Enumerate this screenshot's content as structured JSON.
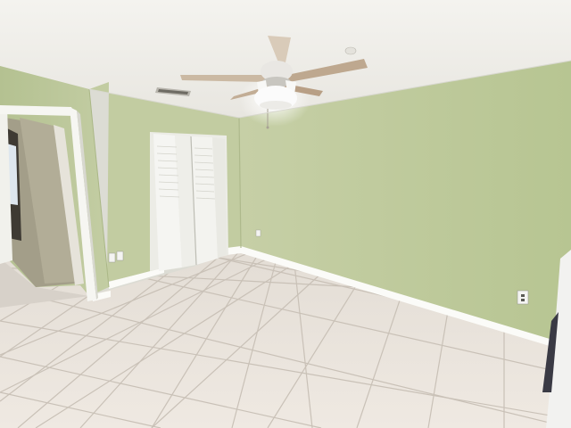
{
  "scene": {
    "description_tags": [
      "empty-bedroom",
      "tile-floor",
      "ceiling-fan",
      "bifold-closet",
      "open-doorway"
    ],
    "colors": {
      "ceiling": "#f1efea",
      "wall_left": "#bcc89c",
      "wall_back": "#c5cfa6",
      "wall_right": "#b9c697",
      "floor": "#ece6df",
      "grout": "#c8c0b6",
      "baseboard": "#fbfbf8",
      "door_trim": "#f6f6f2",
      "closet_door": "#f4f4f1",
      "hallway": "#a39e89"
    }
  }
}
